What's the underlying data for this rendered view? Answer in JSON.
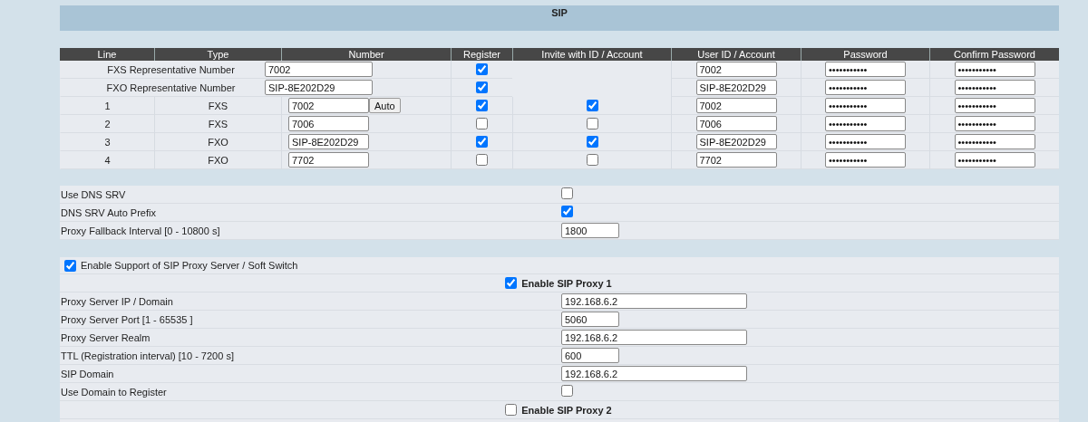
{
  "title": "SIP",
  "lines_table": {
    "columns": [
      "Line",
      "Type",
      "Number",
      "Register",
      "Invite with ID / Account",
      "User ID / Account",
      "Password",
      "Confirm Password"
    ],
    "rows": [
      {
        "kind": "representative",
        "label": "FXS Representative Number",
        "number": "7002",
        "register": true,
        "user_id": "7002",
        "password": "•••••••••••",
        "confirm_password": "•••••••••••"
      },
      {
        "kind": "representative",
        "label": "FXO Representative Number",
        "number": "SIP-8E202D29",
        "register": true,
        "user_id": "SIP-8E202D29",
        "password": "•••••••••••",
        "confirm_password": "•••••••••••"
      },
      {
        "kind": "line",
        "line": "1",
        "type": "FXS",
        "number": "7002",
        "button": "Auto",
        "register": true,
        "invite": true,
        "user_id": "7002",
        "password": "•••••••••••",
        "confirm_password": "•••••••••••"
      },
      {
        "kind": "line",
        "line": "2",
        "type": "FXS",
        "number": "7006",
        "register": false,
        "invite": false,
        "user_id": "7006",
        "password": "•••••••••••",
        "confirm_password": "•••••••••••"
      },
      {
        "kind": "line",
        "line": "3",
        "type": "FXO",
        "number": "SIP-8E202D29",
        "register": true,
        "invite": true,
        "user_id": "SIP-8E202D29",
        "password": "•••••••••••",
        "confirm_password": "•••••••••••"
      },
      {
        "kind": "line",
        "line": "4",
        "type": "FXO",
        "number": "7702",
        "register": false,
        "invite": false,
        "user_id": "7702",
        "password": "•••••••••••",
        "confirm_password": "•••••••••••"
      }
    ]
  },
  "dns_settings": [
    {
      "kind": "checkbox",
      "label": "Use DNS SRV",
      "checked": false
    },
    {
      "kind": "checkbox",
      "label": "DNS SRV Auto Prefix",
      "checked": true
    },
    {
      "kind": "number",
      "label": "Proxy Fallback Interval [0 - 10800 s]",
      "value": "1800"
    }
  ],
  "proxy_settings": [
    {
      "kind": "toggle",
      "label": "Enable Support of SIP Proxy Server / Soft Switch",
      "checked": true
    },
    {
      "kind": "heading",
      "label": "Enable SIP Proxy 1",
      "checked": true
    },
    {
      "kind": "address",
      "label": "Proxy Server IP / Domain",
      "value": "192.168.6.2"
    },
    {
      "kind": "number",
      "label": "Proxy Server Port [1 - 65535 ]",
      "value": "5060"
    },
    {
      "kind": "address",
      "label": "Proxy Server Realm",
      "value": "192.168.6.2"
    },
    {
      "kind": "number",
      "label": "TTL (Registration interval) [10 - 7200 s]",
      "value": "600"
    },
    {
      "kind": "address",
      "label": "SIP Domain",
      "value": "192.168.6.2"
    },
    {
      "kind": "checkbox",
      "label": "Use Domain to Register",
      "checked": false
    },
    {
      "kind": "heading",
      "label": "Enable SIP Proxy 2",
      "checked": false
    }
  ]
}
